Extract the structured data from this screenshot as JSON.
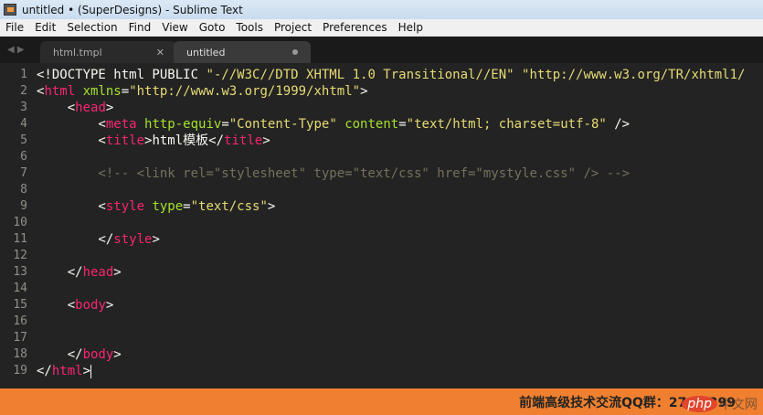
{
  "window": {
    "title": "untitled • (SuperDesigns) - Sublime Text"
  },
  "menu": [
    "File",
    "Edit",
    "Selection",
    "Find",
    "View",
    "Goto",
    "Tools",
    "Project",
    "Preferences",
    "Help"
  ],
  "tabs": [
    {
      "label": "html.tmpl",
      "active": false
    },
    {
      "label": "untitled",
      "active": true
    }
  ],
  "colors": {
    "tag": "#f92672",
    "attr": "#a6e22e",
    "string": "#e6db74",
    "comment": "#75715e",
    "text": "#f8f8f2",
    "status": "#f0802f"
  },
  "lines": [
    [
      [
        "txt",
        "<!DOCTYPE html PUBLIC "
      ],
      [
        "str",
        "\"-//W3C//DTD XHTML 1.0 Transitional//EN\""
      ],
      [
        "txt",
        " "
      ],
      [
        "str",
        "\"http://www.w3.org/TR/xhtml1/"
      ]
    ],
    [
      [
        "txt",
        "<"
      ],
      [
        "tag",
        "html"
      ],
      [
        "txt",
        " "
      ],
      [
        "attr",
        "xmlns"
      ],
      [
        "txt",
        "="
      ],
      [
        "str",
        "\"http://www.w3.org/1999/xhtml\""
      ],
      [
        "txt",
        ">"
      ]
    ],
    [
      [
        "txt",
        "    <"
      ],
      [
        "tag",
        "head"
      ],
      [
        "txt",
        ">"
      ]
    ],
    [
      [
        "txt",
        "        <"
      ],
      [
        "tag",
        "meta"
      ],
      [
        "txt",
        " "
      ],
      [
        "attr",
        "http-equiv"
      ],
      [
        "txt",
        "="
      ],
      [
        "str",
        "\"Content-Type\""
      ],
      [
        "txt",
        " "
      ],
      [
        "attr",
        "content"
      ],
      [
        "txt",
        "="
      ],
      [
        "str",
        "\"text/html; charset=utf-8\""
      ],
      [
        "txt",
        " />"
      ]
    ],
    [
      [
        "txt",
        "        <"
      ],
      [
        "tag",
        "title"
      ],
      [
        "txt",
        ">html模板</"
      ],
      [
        "tag",
        "title"
      ],
      [
        "txt",
        ">"
      ]
    ],
    [],
    [
      [
        "cmt",
        "        <!-- <link rel=\"stylesheet\" type=\"text/css\" href=\"mystyle.css\" /> -->"
      ]
    ],
    [],
    [
      [
        "txt",
        "        <"
      ],
      [
        "tag",
        "style"
      ],
      [
        "txt",
        " "
      ],
      [
        "attr",
        "type"
      ],
      [
        "txt",
        "="
      ],
      [
        "str",
        "\"text/css\""
      ],
      [
        "txt",
        ">"
      ]
    ],
    [],
    [
      [
        "txt",
        "        </"
      ],
      [
        "tag",
        "style"
      ],
      [
        "txt",
        ">"
      ]
    ],
    [],
    [
      [
        "txt",
        "    </"
      ],
      [
        "tag",
        "head"
      ],
      [
        "txt",
        ">"
      ]
    ],
    [],
    [
      [
        "txt",
        "    <"
      ],
      [
        "tag",
        "body"
      ],
      [
        "txt",
        ">"
      ]
    ],
    [],
    [],
    [
      [
        "txt",
        "    </"
      ],
      [
        "tag",
        "body"
      ],
      [
        "txt",
        ">"
      ]
    ],
    [
      [
        "txt",
        "</"
      ],
      [
        "tag",
        "html"
      ],
      [
        "txt",
        ">"
      ]
    ]
  ],
  "status": {
    "text": "前端高级技术交流QQ群：27  22399"
  },
  "watermark": {
    "text": "php中文网"
  }
}
